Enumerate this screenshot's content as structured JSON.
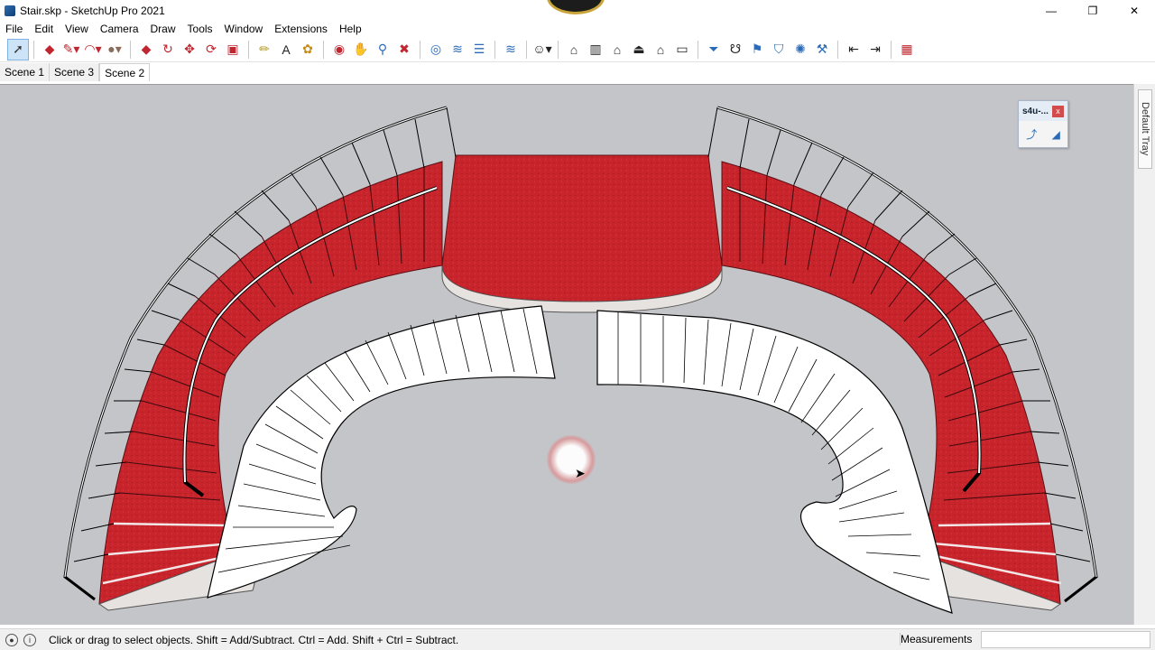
{
  "window": {
    "title": "Stair.skp - SketchUp Pro 2021",
    "minimize_glyph": "—",
    "restore_glyph": "❐",
    "close_glyph": "✕"
  },
  "menu": {
    "items": [
      "File",
      "Edit",
      "View",
      "Camera",
      "Draw",
      "Tools",
      "Window",
      "Extensions",
      "Help"
    ]
  },
  "toolbar": {
    "groups": [
      [
        "select-icon",
        "eraser-icon",
        "pencil-icon",
        "arc-icon",
        "paint-bucket-icon"
      ],
      [
        "push-pull-icon",
        "follow-me-icon",
        "move-icon",
        "rotate-icon",
        "scale-icon"
      ],
      [
        "tape-measure-icon",
        "text-icon",
        "paint-icon"
      ],
      [
        "orbit-icon",
        "pan-icon",
        "zoom-icon",
        "zoom-extents-icon"
      ],
      [
        "section-plane-icon",
        "section-display-icon",
        "layers-icon",
        "styles-icon"
      ],
      [
        "user-icon"
      ],
      [
        "warehouse-icon",
        "component-icon",
        "house-icon",
        "house-roof-icon",
        "house-outline-icon",
        "box-icon"
      ],
      [
        "funnel-icon",
        "lasso-icon",
        "flag-icon",
        "shield-icon",
        "sparkle-icon",
        "paint-roller-icon",
        "arrow-left-icon",
        "arrow-right-icon"
      ],
      [
        "brick-wall-icon"
      ]
    ]
  },
  "tabs": [
    {
      "label": "Scene 1",
      "active": false
    },
    {
      "label": "Scene 3",
      "active": false
    },
    {
      "label": "Scene 2",
      "active": true
    }
  ],
  "tray": {
    "label": "Default Tray"
  },
  "floating_panel": {
    "title": "s4u-...",
    "close_label": "x",
    "tools": [
      "stair-curve-icon",
      "stair-ramp-icon"
    ]
  },
  "status": {
    "message": "Click or drag to select objects. Shift = Add/Subtract. Ctrl = Add. Shift + Ctrl = Subtract.",
    "measurements_label": "Measurements",
    "measurements_value": ""
  },
  "colors": {
    "background": "#c4c5c9",
    "carpet_red": "#c8242c",
    "white_step": "#ffffff",
    "highlight": "#e06767"
  }
}
